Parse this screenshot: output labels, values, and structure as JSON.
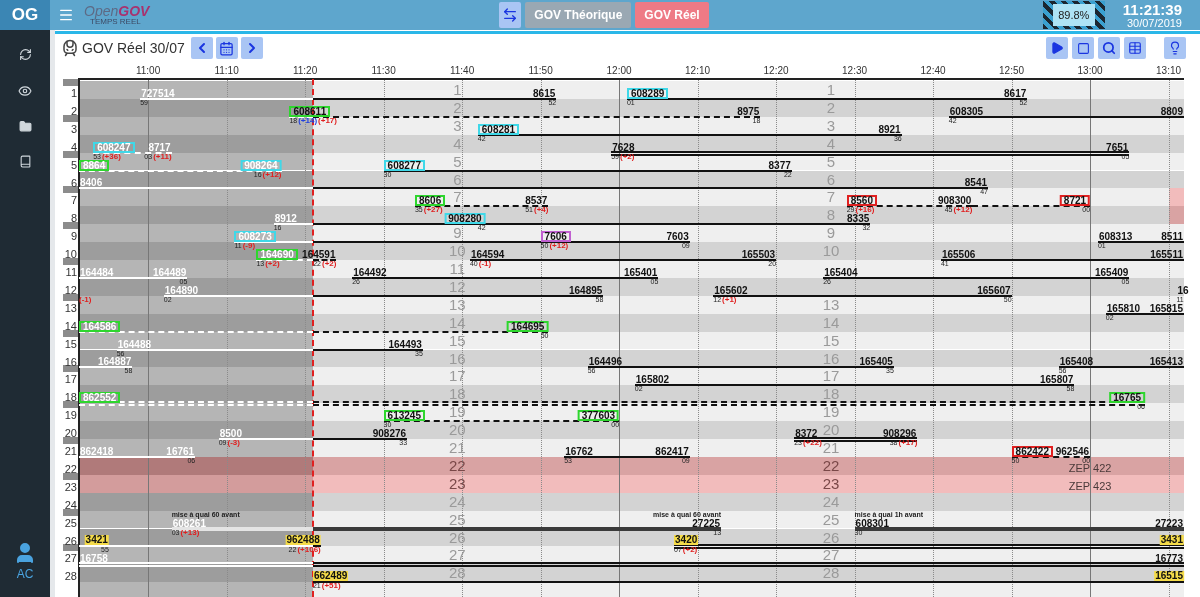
{
  "app": {
    "badge": "OG",
    "logo": {
      "name_parts": [
        "Open",
        "GOV"
      ],
      "subtitle": "TEMPS REEL"
    }
  },
  "mode_tabs": [
    {
      "label": "GOV Théorique",
      "selected": false
    },
    {
      "label": "GOV Réel",
      "selected": true
    }
  ],
  "load_indicator": "89.8%",
  "clock": {
    "time": "11:21:39",
    "date": "30/07/2019"
  },
  "user": {
    "initials": "AC"
  },
  "view": {
    "title": "GOV Réel 30/07"
  },
  "time_axis": [
    "11:00",
    "11:10",
    "11:20",
    "11:30",
    "11:40",
    "11:50",
    "12:00",
    "12:10",
    "12:20",
    "12:30",
    "12:40",
    "12:50",
    "13:00",
    "13:10"
  ],
  "tracks": [
    {
      "number": "1",
      "middle_number": "1",
      "right_number": "1",
      "segments": [
        {
          "kind": "solid",
          "start": {
            "kind": "plain",
            "text": "727514",
            "minute": "59"
          },
          "end": {
            "kind": "plain",
            "text": "8615",
            "minute": "52"
          }
        },
        {
          "kind": "solid",
          "start": {
            "kind": "framed",
            "color": "#3fd8e8",
            "text": "608289",
            "minute": "01"
          },
          "end": {
            "kind": "plain",
            "text": "8617",
            "minute": "52"
          }
        }
      ]
    },
    {
      "number": "2",
      "middle_number": "2",
      "right_number": "2",
      "segments": [
        {
          "kind": "dashed",
          "start": {
            "kind": "framed",
            "color": "#2ed62e",
            "text": "608611",
            "minute": "18",
            "delays": [
              {
                "text": "(+14)",
                "color": "#2040e0"
              },
              {
                "text": "(+17)",
                "color": "#e02020"
              }
            ]
          },
          "end": {
            "kind": "plain",
            "text": "8975",
            "minute": "18"
          }
        },
        {
          "kind": "solid",
          "start": {
            "kind": "plain",
            "text": "608305",
            "minute": "42"
          },
          "end": {
            "kind": "plain",
            "text": "8809"
          }
        }
      ]
    },
    {
      "number": "3",
      "middle_number": "3",
      "right_number": "3",
      "segments": [
        {
          "kind": "solid",
          "start": {
            "kind": "framed",
            "color": "#3fd8e8",
            "text": "608281",
            "minute": "42"
          },
          "end": {
            "kind": "plain",
            "text": "8921",
            "minute": "36"
          }
        }
      ]
    },
    {
      "number": "4",
      "middle_number": "4",
      "right_number": "4",
      "segments": [
        {
          "kind": "dashed",
          "start": {
            "kind": "framed",
            "color": "#3fd8e8",
            "text": "608247",
            "minute": "53",
            "delays": [
              {
                "text": "(+36)",
                "color": "#e02020"
              }
            ]
          },
          "end": {
            "kind": "plain",
            "text": "8717",
            "minute": "03",
            "delays": [
              {
                "text": "(+11)",
                "color": "#e02020"
              }
            ]
          }
        },
        {
          "kind": "double",
          "start": {
            "kind": "plain",
            "text": "7628",
            "minute": "59",
            "delays": [
              {
                "text": "(+2)",
                "color": "#e02020"
              }
            ]
          },
          "end": {
            "kind": "plain",
            "text": "7651",
            "minute": "05"
          }
        }
      ]
    },
    {
      "number": "5",
      "middle_number": "5",
      "right_number": "5",
      "segments": [
        {
          "kind": "dashed",
          "start": {
            "kind": "framed",
            "color": "#2ed62e",
            "text": "8864"
          },
          "end": {
            "kind": "framed",
            "color": "#3fd8e8",
            "text": "908264",
            "minute": "16",
            "delays": [
              {
                "text": "(+12)",
                "color": "#e02020"
              }
            ]
          }
        },
        {
          "kind": "solid",
          "start": {
            "kind": "framed",
            "color": "#3fd8e8",
            "text": "608277",
            "minute": "30"
          },
          "end": {
            "kind": "plain",
            "text": "8377",
            "minute": "22"
          }
        }
      ]
    },
    {
      "number": "6",
      "middle_number": "6",
      "right_number": "6",
      "segments": [
        {
          "kind": "solid",
          "start": {
            "kind": "plain",
            "text": "8406"
          },
          "end": {
            "kind": "plain",
            "text": "8541",
            "minute": "47"
          }
        }
      ]
    },
    {
      "number": "7",
      "middle_number": "7",
      "right_number": "7",
      "blocked": true,
      "segments": [
        {
          "kind": "dashed",
          "start": {
            "kind": "framed",
            "color": "#2ed62e",
            "text": "8606",
            "minute": "35",
            "delays": [
              {
                "text": "(+27)",
                "color": "#e02020"
              }
            ]
          },
          "end": {
            "kind": "plain",
            "text": "8537",
            "minute": "51",
            "delays": [
              {
                "text": "(+4)",
                "color": "#e02020"
              }
            ]
          }
        },
        {
          "kind": "dashed",
          "start": {
            "kind": "framed",
            "color": "#e02020",
            "text": "8560",
            "minute": "29",
            "delays": [
              {
                "text": "(+16)",
                "color": "#e02020"
              }
            ]
          },
          "end": {
            "kind": "plain",
            "text": "908300",
            "minute": "45",
            "delays": [
              {
                "text": "(+12)",
                "color": "#e02020"
              }
            ]
          }
        },
        {
          "kind": "dashed",
          "end": {
            "kind": "framed",
            "color": "#e02020",
            "text": "8721",
            "minute": "00"
          }
        }
      ]
    },
    {
      "number": "8",
      "right_number": "8",
      "blocked": true,
      "segments": [
        {
          "kind": "solid",
          "start": {
            "kind": "plain",
            "text": "8912",
            "minute": "16"
          },
          "end": {
            "kind": "framed",
            "color": "#3fd8e8",
            "text": "908280",
            "minute": "42"
          }
        },
        {
          "kind": "solid",
          "end": {
            "kind": "plain",
            "text": "8335",
            "minute": "32"
          }
        }
      ]
    },
    {
      "number": "9",
      "middle_number": "9",
      "right_number": "9",
      "segments": [
        {
          "kind": "solid",
          "start": {
            "kind": "framed",
            "color": "#3fd8e8",
            "text": "608273",
            "minute": "11",
            "delays": [
              {
                "text": "(-9)",
                "color": "#e02020"
              }
            ]
          }
        },
        {
          "kind": "solid",
          "start": {
            "kind": "framed",
            "color": "#c060d0",
            "text": "7606",
            "minute": "50",
            "delays": [
              {
                "text": "(+12)",
                "color": "#e02020"
              }
            ]
          },
          "end": {
            "kind": "plain",
            "text": "7603",
            "minute": "09"
          }
        },
        {
          "kind": "solid",
          "start": {
            "kind": "plain",
            "text": "608313",
            "minute": "01"
          },
          "end": {
            "kind": "plain",
            "text": "8511"
          }
        }
      ]
    },
    {
      "number": "10",
      "middle_number": "10",
      "right_number": "10",
      "segments": [
        {
          "kind": "dashed",
          "start": {
            "kind": "framed",
            "color": "#2ed62e",
            "text": "164690",
            "minute": "13",
            "delays": [
              {
                "text": "(+2)",
                "color": "#e02020"
              }
            ]
          },
          "end": {
            "kind": "plain",
            "text": "164591",
            "minute": "22",
            "delays": [
              {
                "text": "(+2)",
                "color": "#e02020"
              }
            ]
          }
        },
        {
          "kind": "solid",
          "start": {
            "kind": "plain",
            "text": "164594",
            "minute": "40",
            "delays": [
              {
                "text": "(-1)",
                "color": "#e02020"
              }
            ]
          },
          "end": {
            "kind": "plain",
            "text": "165503",
            "minute": "20"
          }
        },
        {
          "kind": "solid",
          "start": {
            "kind": "plain",
            "text": "165506",
            "minute": "41"
          },
          "end": {
            "kind": "plain",
            "text": "165511"
          }
        }
      ]
    },
    {
      "number": "11",
      "middle_number": "11",
      "segments": [
        {
          "kind": "solid",
          "start": {
            "kind": "plain",
            "text": "164484"
          },
          "end": {
            "kind": "plain",
            "text": "164489",
            "minute": "05"
          }
        },
        {
          "kind": "solid",
          "start": {
            "kind": "plain",
            "text": "164492",
            "minute": "26"
          },
          "end": {
            "kind": "plain",
            "text": "165401",
            "minute": "05"
          }
        },
        {
          "kind": "solid",
          "start": {
            "kind": "plain",
            "text": "165404",
            "minute": "26"
          },
          "end": {
            "kind": "plain",
            "text": "165409",
            "minute": "05"
          }
        }
      ]
    },
    {
      "number": "12",
      "middle_number": "12",
      "segments": [
        {
          "kind": "solid",
          "start": {
            "kind": "plain",
            "delays": [
              {
                "text": "(-1)",
                "color": "#e02020"
              }
            ]
          }
        },
        {
          "kind": "solid",
          "start": {
            "kind": "plain",
            "text": "164890",
            "minute": "02"
          },
          "end": {
            "kind": "plain",
            "text": "164895",
            "minute": "58"
          }
        },
        {
          "kind": "solid",
          "start": {
            "kind": "plain",
            "text": "165602",
            "minute": "12",
            "delays": [
              {
                "text": "(+1)",
                "color": "#e02020"
              }
            ]
          },
          "end": {
            "kind": "plain",
            "text": "165607",
            "minute": "50"
          }
        },
        {
          "kind": "solid",
          "start": {
            "kind": "plain",
            "text": "16",
            "minute": "11"
          }
        }
      ]
    },
    {
      "number": "13",
      "middle_number": "13",
      "right_number": "13",
      "segments": [
        {
          "kind": "solid",
          "start": {
            "kind": "plain",
            "text": "165810",
            "minute": "02"
          },
          "end": {
            "kind": "plain",
            "text": "165815"
          }
        }
      ]
    },
    {
      "number": "14",
      "middle_number": "14",
      "right_number": "14",
      "segments": [
        {
          "kind": "dashed",
          "start": {
            "kind": "framed",
            "color": "#2ed62e",
            "text": "164586"
          },
          "end": {
            "kind": "framed",
            "color": "#2ed62e",
            "text": "164695",
            "minute": "50"
          }
        }
      ]
    },
    {
      "number": "15",
      "middle_number": "15",
      "right_number": "15",
      "segments": [
        {
          "kind": "solid",
          "start": {
            "kind": "plain",
            "text": "164488",
            "minute": "56"
          },
          "end": {
            "kind": "plain",
            "text": "164493",
            "minute": "35"
          }
        }
      ]
    },
    {
      "number": "16",
      "middle_number": "16",
      "right_number": "16",
      "segments": [
        {
          "kind": "solid",
          "end": {
            "kind": "plain",
            "text": "164887",
            "minute": "58"
          }
        },
        {
          "kind": "solid",
          "start": {
            "kind": "plain",
            "text": "164496",
            "minute": "56"
          },
          "end": {
            "kind": "plain",
            "text": "165405",
            "minute": "35"
          }
        },
        {
          "kind": "solid",
          "start": {
            "kind": "plain",
            "text": "165408",
            "minute": "56"
          },
          "end": {
            "kind": "plain",
            "text": "165413"
          }
        }
      ]
    },
    {
      "number": "17",
      "middle_number": "17",
      "right_number": "17",
      "segments": [
        {
          "kind": "solid",
          "start": {
            "kind": "plain",
            "text": "165802",
            "minute": "02"
          },
          "end": {
            "kind": "plain",
            "text": "165807",
            "minute": "58"
          }
        }
      ]
    },
    {
      "number": "18",
      "middle_number": "18",
      "right_number": "18",
      "segments": [
        {
          "kind": "double-dashed",
          "start": {
            "kind": "framed",
            "color": "#2ed62e",
            "text": "862552"
          },
          "end": {
            "kind": "framed",
            "color": "#2ed62e",
            "text": "16765",
            "minute": "06"
          }
        }
      ]
    },
    {
      "number": "19",
      "middle_number": "19",
      "right_number": "19",
      "segments": [
        {
          "kind": "dashed",
          "start": {
            "kind": "framed",
            "color": "#2ed62e",
            "text": "613245",
            "minute": "30"
          },
          "end": {
            "kind": "framed",
            "color": "#2ed62e",
            "text": "377603",
            "minute": "00"
          }
        }
      ]
    },
    {
      "number": "20",
      "middle_number": "20",
      "right_number": "20",
      "segments": [
        {
          "kind": "solid",
          "start": {
            "kind": "plain",
            "text": "8500",
            "minute": "09",
            "delays": [
              {
                "text": "(-3)",
                "color": "#e02020"
              }
            ]
          },
          "end": {
            "kind": "plain",
            "text": "908276",
            "minute": "33"
          }
        },
        {
          "kind": "double",
          "start": {
            "kind": "plain",
            "text": "8372",
            "minute": "23",
            "delays": [
              {
                "text": "(+22)",
                "color": "#e02020"
              }
            ]
          },
          "end": {
            "kind": "plain",
            "text": "908296",
            "minute": "38",
            "delays": [
              {
                "text": "(+17)",
                "color": "#e02020"
              }
            ]
          }
        }
      ]
    },
    {
      "number": "21",
      "middle_number": "21",
      "right_number": "21",
      "segments": [
        {
          "kind": "solid",
          "start": {
            "kind": "plain",
            "text": "862418"
          },
          "end": {
            "kind": "plain",
            "text": "16761",
            "minute": "06"
          }
        },
        {
          "kind": "solid",
          "start": {
            "kind": "plain",
            "text": "16762",
            "minute": "53"
          },
          "end": {
            "kind": "plain",
            "text": "862417",
            "minute": "09"
          }
        },
        {
          "kind": "dashed",
          "start": {
            "kind": "framed",
            "color": "#e02020",
            "text": "862422",
            "minute": "50"
          },
          "end": {
            "kind": "plain",
            "text": "962546",
            "minute": "00"
          }
        }
      ]
    },
    {
      "number": "22",
      "middle_number": "22",
      "right_number": "22",
      "blocked": true,
      "closure_label": "ZEP 422"
    },
    {
      "number": "23",
      "middle_number": "23",
      "right_number": "23",
      "blocked": true,
      "closure_label": "ZEP 423"
    },
    {
      "number": "24",
      "middle_number": "24",
      "right_number": "24"
    },
    {
      "number": "25",
      "middle_number": "25",
      "right_number": "25",
      "segments": [
        {
          "kind": "heavy",
          "start": {
            "kind": "plain",
            "text": "608261",
            "minute": "03",
            "note": "mise à quai 60 avant",
            "delays": [
              {
                "text": "(+13)",
                "color": "#e02020"
              }
            ]
          },
          "end": {
            "kind": "plain",
            "text": "27225",
            "minute": "13",
            "note": "mise à quai 60 avant"
          }
        },
        {
          "kind": "heavy",
          "start": {
            "kind": "plain",
            "text": "608301",
            "minute": "30",
            "note": "mise à quai 1h avant"
          },
          "end": {
            "kind": "plain",
            "text": "27223"
          }
        }
      ]
    },
    {
      "number": "26",
      "middle_number": "26",
      "right_number": "26",
      "segments": [
        {
          "kind": "solid",
          "end": {
            "kind": "highlight",
            "text": "3421",
            "minute": "55"
          }
        },
        {
          "kind": "solid",
          "end": {
            "kind": "highlight",
            "text": "962488",
            "minute": "22",
            "delays": [
              {
                "text": "(+106)",
                "color": "#e02020"
              }
            ]
          }
        },
        {
          "kind": "double",
          "start": {
            "kind": "highlight",
            "text": "3420",
            "minute": "07",
            "delays": [
              {
                "text": "(+2)",
                "color": "#e02020"
              }
            ]
          },
          "end": {
            "kind": "highlight",
            "text": "3431"
          }
        }
      ]
    },
    {
      "number": "27",
      "middle_number": "27",
      "right_number": "27",
      "segments": [
        {
          "kind": "double",
          "start": {
            "kind": "plain",
            "text": "16758"
          },
          "end": {
            "kind": "plain",
            "text": "16773"
          }
        }
      ]
    },
    {
      "number": "28",
      "middle_number": "28",
      "right_number": "28",
      "segments": [
        {
          "kind": "solid",
          "start": {
            "kind": "highlight",
            "text": "662489",
            "minute": "21",
            "delays": [
              {
                "text": "(+51)",
                "color": "#e02020"
              }
            ]
          },
          "end": {
            "kind": "highlight",
            "text": "16515"
          }
        }
      ]
    }
  ]
}
